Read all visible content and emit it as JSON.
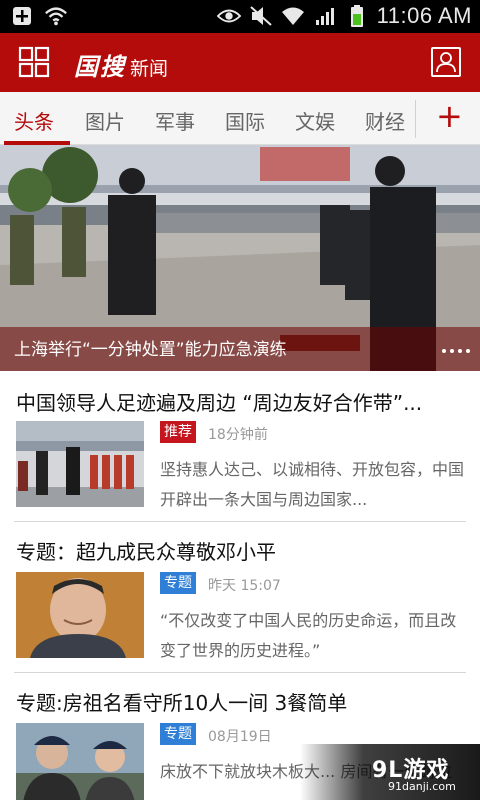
{
  "status_bar": {
    "time": "11:06 AM",
    "icons": [
      "add-box-icon",
      "wifi-sync-icon",
      "eye-icon",
      "mute-icon",
      "wifi-icon",
      "signal-icon",
      "battery-icon"
    ]
  },
  "header": {
    "logo_main": "国搜",
    "logo_sub": "新闻",
    "brand_color": "#b40b0b"
  },
  "tabs": [
    {
      "label": "头条",
      "active": true
    },
    {
      "label": "图片"
    },
    {
      "label": "军事"
    },
    {
      "label": "国际"
    },
    {
      "label": "文娱"
    },
    {
      "label": "财经"
    }
  ],
  "tab_add_label": "+",
  "hero": {
    "caption": "上海举行“一分钟处置”能力应急演练"
  },
  "news": [
    {
      "title": "中国领导人足迹遍及周边 “周边友好合作带”...",
      "tag": "推荐",
      "tag_color": "#c4161c",
      "time": "18分钟前",
      "summary": "坚持惠人达己、以诚相待、开放包容，中国开辟出一条大国与周边国家..."
    },
    {
      "title": "专题：超九成民众尊敬邓小平",
      "tag": "专题",
      "tag_color": "#2f7fd6",
      "time": "昨天 15:07",
      "summary": "“不仅改变了中国人民的历史命运，而且改变了世界的历史进程。”"
    },
    {
      "title": "专题:房祖名看守所10人一间 3餐简单",
      "tag": "专题",
      "tag_color": "#2f7fd6",
      "time": "08月19日",
      "summary": "床放不下就放块木板大... 房间有一个蹲位"
    }
  ],
  "watermark": {
    "main": "9L游戏",
    "sub": "91danji.com"
  }
}
